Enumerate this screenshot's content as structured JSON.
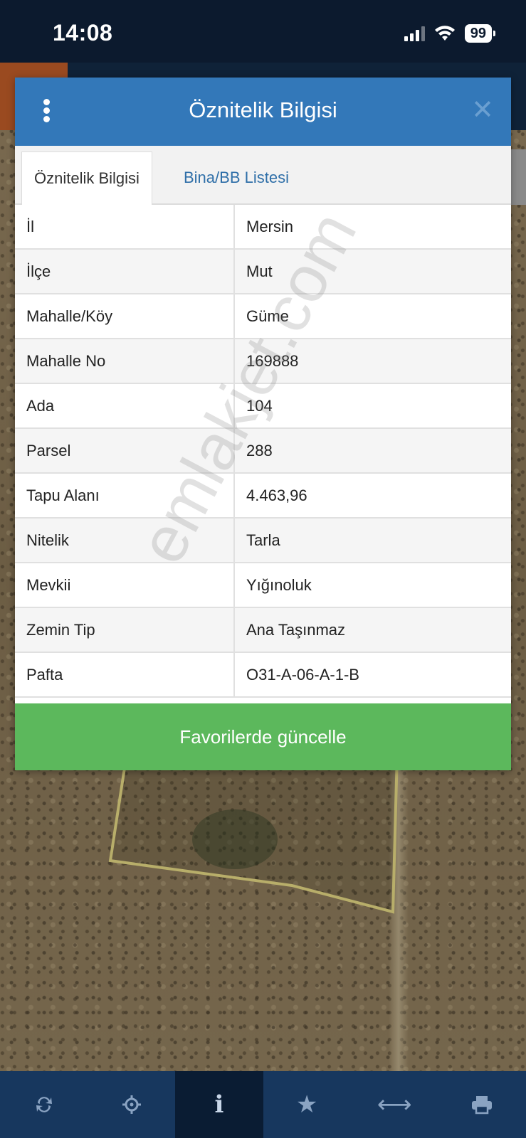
{
  "status": {
    "time": "14:08",
    "battery": "99"
  },
  "dialog": {
    "title": "Öznitelik Bilgisi",
    "tabs": [
      {
        "label": "Öznitelik Bilgisi",
        "active": true
      },
      {
        "label": "Bina/BB Listesi",
        "active": false
      }
    ],
    "rows": [
      {
        "key": "İl",
        "value": "Mersin"
      },
      {
        "key": "İlçe",
        "value": "Mut"
      },
      {
        "key": "Mahalle/Köy",
        "value": "Güme"
      },
      {
        "key": "Mahalle No",
        "value": "169888"
      },
      {
        "key": "Ada",
        "value": "104"
      },
      {
        "key": "Parsel",
        "value": "288"
      },
      {
        "key": "Tapu Alanı",
        "value": "4.463,96"
      },
      {
        "key": "Nitelik",
        "value": "Tarla"
      },
      {
        "key": "Mevkii",
        "value": "Yığınoluk"
      },
      {
        "key": "Zemin Tip",
        "value": "Ana Taşınmaz"
      },
      {
        "key": "Pafta",
        "value": "O31-A-06-A-1-B"
      }
    ],
    "favorite_button": "Favorilerde güncelle"
  },
  "watermark": "emlakjet.com",
  "toolbar": {
    "items": [
      {
        "icon": "refresh-icon",
        "active": false
      },
      {
        "icon": "locate-icon",
        "active": false
      },
      {
        "icon": "info-icon",
        "active": true
      },
      {
        "icon": "star-icon",
        "active": false
      },
      {
        "icon": "measure-icon",
        "active": false
      },
      {
        "icon": "print-icon",
        "active": false
      }
    ]
  },
  "colors": {
    "header": "#3378b9",
    "button": "#5cb85c",
    "toolbar": "#17375e",
    "toolbar_active": "#0a1c33"
  }
}
